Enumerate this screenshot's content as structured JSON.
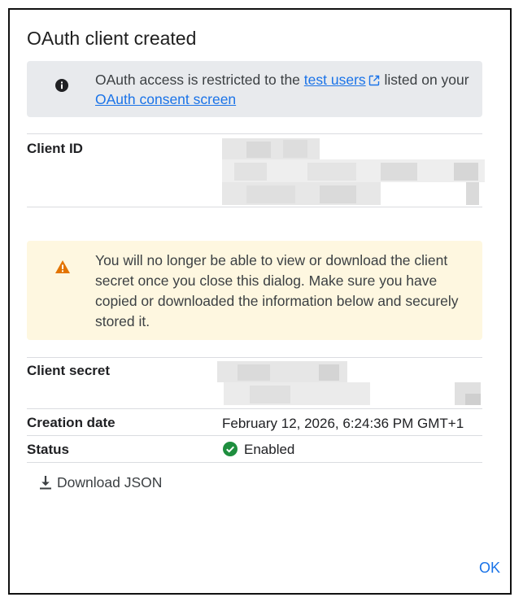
{
  "dialog": {
    "title": "OAuth client created",
    "info": {
      "icon": "info-icon",
      "text_before": "OAuth access is restricted to the ",
      "link_test_users": "test users",
      "text_mid": " listed on your ",
      "link_consent": "OAuth consent screen"
    },
    "client_id": {
      "label": "Client ID"
    },
    "warning": {
      "icon": "warning-icon",
      "text": "You will no longer be able to view or download the client secret once you close this dialog. Make sure you have copied or downloaded the information below and securely stored it."
    },
    "client_secret": {
      "label": "Client secret"
    },
    "creation_date": {
      "label": "Creation date",
      "value": "February 12, 2026, 6:24:36 PM GMT+1"
    },
    "status": {
      "label": "Status",
      "value": "Enabled",
      "icon": "check-circle-icon"
    },
    "download": {
      "label": "Download JSON",
      "icon": "download-icon"
    },
    "ok_label": "OK",
    "colors": {
      "link": "#1a73e8",
      "info_bg": "#e8eaed",
      "warn_bg": "#fef7e0",
      "warn_icon": "#e37400",
      "success": "#1e8e3e"
    }
  }
}
